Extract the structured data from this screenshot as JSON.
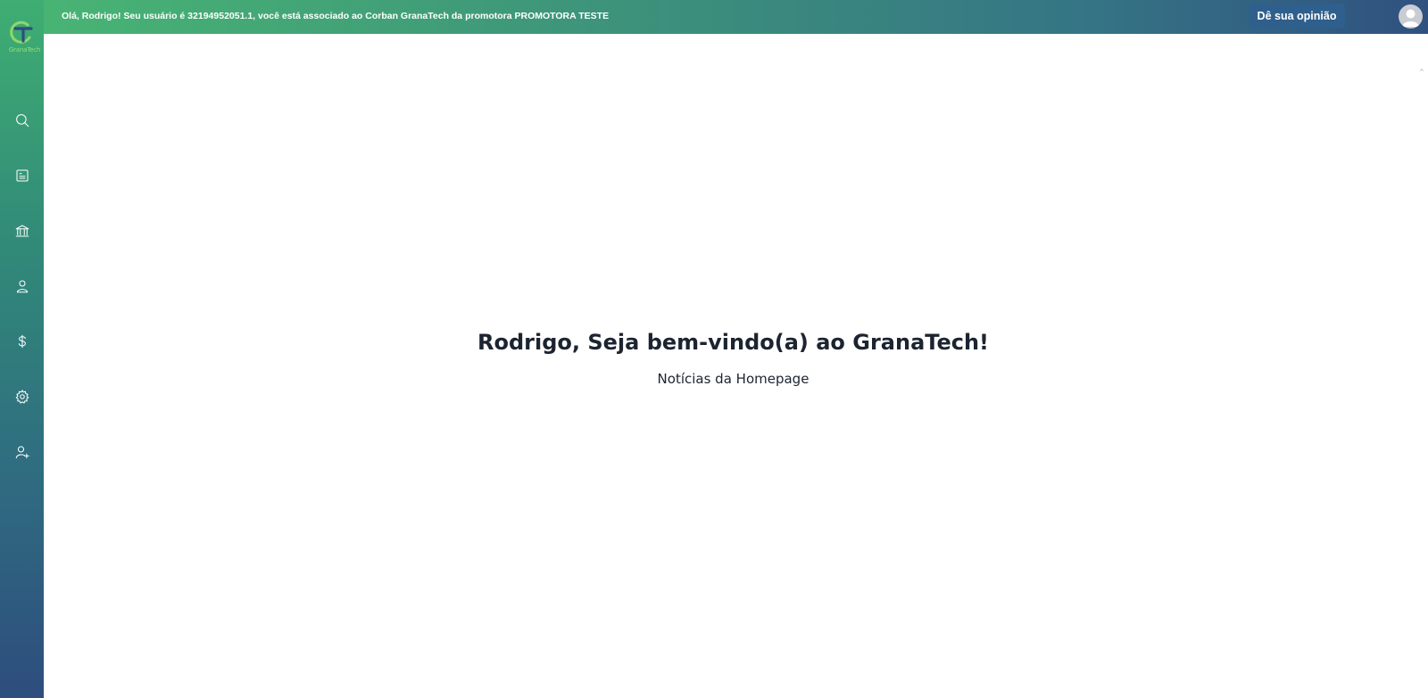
{
  "brand": {
    "logo_text": "GranaTech",
    "primary_green": "#48b474",
    "primary_blue": "#2e4d7e"
  },
  "topbar": {
    "welcome_message": "Olá, Rodrigo! Seu usuário é 32194952051.1, você está associado ao Corban GranaTech da promotora PROMOTORA TESTE",
    "feedback_label": "Dê sua opinião"
  },
  "sidebar": {
    "items": [
      {
        "icon": "search-icon"
      },
      {
        "icon": "document-icon"
      },
      {
        "icon": "bank-icon"
      },
      {
        "icon": "user-icon"
      },
      {
        "icon": "dollar-icon"
      },
      {
        "icon": "gear-icon"
      },
      {
        "icon": "add-user-icon"
      }
    ]
  },
  "main": {
    "headline": "Rodrigo, Seja bem-vindo(a) ao GranaTech!",
    "subheadline": "Notícias da Homepage"
  }
}
